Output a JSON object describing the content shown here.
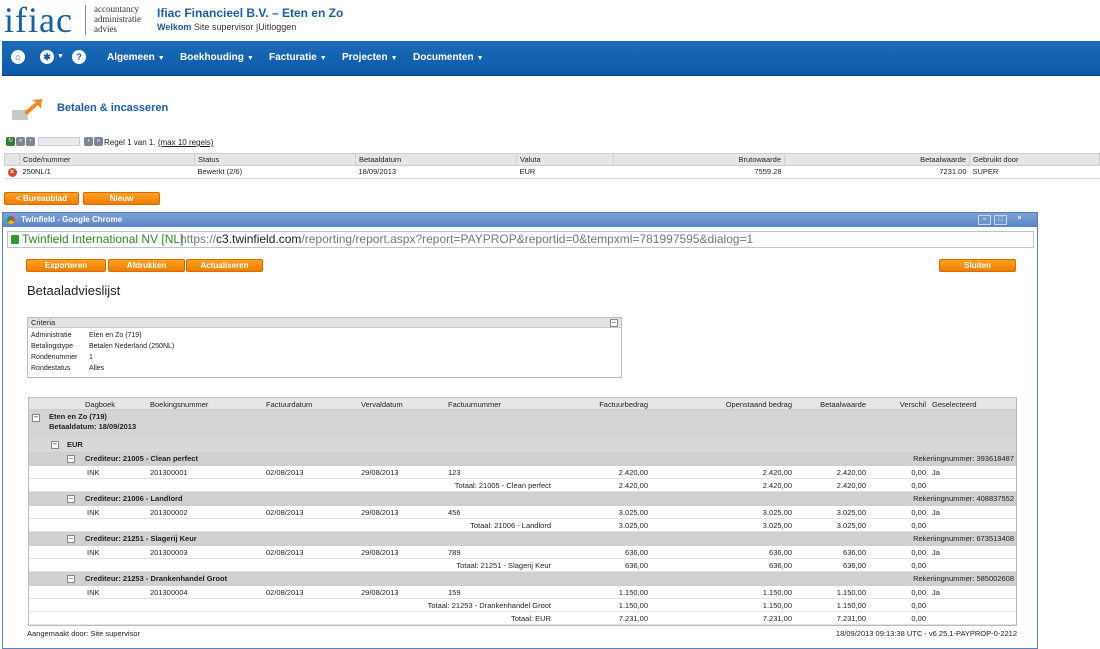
{
  "header": {
    "logo": "ifiac",
    "tagline": [
      "accountancy",
      "administratie",
      "advies"
    ],
    "company": "Ifiac Financieel B.V. – Eten en Zo",
    "welcome": "Welkom",
    "user": "Site supervisor",
    "separator": "|",
    "logout": "Uitloggen"
  },
  "nav": {
    "icons": [
      "home-icon",
      "star-icon",
      "help-icon"
    ],
    "help_glyph": "?",
    "items": [
      "Algemeen",
      "Boekhouding",
      "Facturatie",
      "Projecten",
      "Documenten"
    ]
  },
  "page": {
    "title": "Betalen & incasseren"
  },
  "pager": {
    "text": "Regel 1 van 1.",
    "max": "(max 10 regels)"
  },
  "table": {
    "headers": [
      "Code/nummer",
      "Status",
      "Betaaldatum",
      "Valuta",
      "Brutowaarde",
      "Betaalwaarde",
      "Gebruikt door"
    ],
    "rows": [
      {
        "code": "250NL/1",
        "status": "Bewerkt (2/6)",
        "date": "18/09/2013",
        "currency": "EUR",
        "gross": "7559.28",
        "pay": "7231.00",
        "user": "SUPER"
      }
    ]
  },
  "buttons": {
    "back": "< Bureaublad",
    "new": "Nieuw"
  },
  "popup": {
    "title": "Twinfield - Google Chrome",
    "site": "Twinfield International NV [NL]",
    "url_scheme": "https://",
    "url_host": "c3.twinfield.com",
    "url_path": "/reporting/report.aspx?report=PAYPROP&reportid=0&tempxml=781997595&dialog=1",
    "btn_export": "Exporteren",
    "btn_print": "Afdrukken",
    "btn_refresh": "Actualiseren",
    "btn_close": "Sluiten",
    "report_title": "Betaaladvieslijst",
    "criteria": {
      "label": "Criteria",
      "rows": [
        {
          "k": "Administratie",
          "v": "Eten en Zo (719)"
        },
        {
          "k": "Betalingstype",
          "v": "Betalen Nederland (250NL)"
        },
        {
          "k": "Rondenummer",
          "v": "1"
        },
        {
          "k": "Rondestatus",
          "v": "Alles"
        }
      ]
    },
    "report": {
      "headers": [
        "Dagboek",
        "Boekingsnummer",
        "Factuurdatum",
        "Vervaldatum",
        "Factuurnummer",
        "Factuurbedrag",
        "Openstaand bedrag",
        "Betaalwaarde",
        "Verschil",
        "Geselecteerd"
      ],
      "group": "Eten en Zo (719)",
      "group_date": "Betaaldatum: 18/09/2013",
      "currency": "EUR",
      "creditors": [
        {
          "name": "Crediteur: 21005 - Clean perfect",
          "account": "Rekeningnummer: 393618487",
          "journal": "INK",
          "booking": "201300001",
          "inv_date": "02/08/2013",
          "due": "29/08/2013",
          "inv_no": "123",
          "amount": "2.420,00",
          "open": "2.420,00",
          "pay": "2.420,00",
          "diff": "0,00",
          "sel": "Ja",
          "total_label": "Totaal: 21005 - Clean perfect",
          "t_amount": "2.420,00",
          "t_open": "2.420,00",
          "t_pay": "2.420,00",
          "t_diff": "0,00"
        },
        {
          "name": "Crediteur: 21006 - Landlord",
          "account": "Rekeningnummer: 408837552",
          "journal": "INK",
          "booking": "201300002",
          "inv_date": "02/08/2013",
          "due": "29/08/2013",
          "inv_no": "456",
          "amount": "3.025,00",
          "open": "3.025,00",
          "pay": "3.025,00",
          "diff": "0,00",
          "sel": "Ja",
          "total_label": "Totaal: 21006 - Landlord",
          "t_amount": "3.025,00",
          "t_open": "3.025,00",
          "t_pay": "3.025,00",
          "t_diff": "0,00"
        },
        {
          "name": "Crediteur: 21251 - Slagerij Keur",
          "account": "Rekeningnummer: 673513408",
          "journal": "INK",
          "booking": "201300003",
          "inv_date": "02/08/2013",
          "due": "29/08/2013",
          "inv_no": "789",
          "amount": "636,00",
          "open": "636,00",
          "pay": "636,00",
          "diff": "0,00",
          "sel": "Ja",
          "total_label": "Totaal: 21251 - Slagerij Keur",
          "t_amount": "636,00",
          "t_open": "636,00",
          "t_pay": "636,00",
          "t_diff": "0,00"
        },
        {
          "name": "Crediteur: 21253 - Drankenhandel Groot",
          "account": "Rekeningnummer: 585002608",
          "journal": "INK",
          "booking": "201300004",
          "inv_date": "02/08/2013",
          "due": "29/08/2013",
          "inv_no": "159",
          "amount": "1.150,00",
          "open": "1.150,00",
          "pay": "1.150,00",
          "diff": "0,00",
          "sel": "Ja",
          "total_label": "Totaal: 21253 - Drankenhandel Groot",
          "t_amount": "1.150,00",
          "t_open": "1.150,00",
          "t_pay": "1.150,00",
          "t_diff": "0,00"
        }
      ],
      "grand_total": {
        "label": "Totaal: EUR",
        "amount": "7.231,00",
        "open": "7.231,00",
        "pay": "7.231,00",
        "diff": "0,00"
      }
    },
    "footer_left": "Aangemaakt door: Site supervisor",
    "footer_right": "18/09/2013 09:13:38 UTC - v6.25.1-PAYPROP-0-2212"
  }
}
